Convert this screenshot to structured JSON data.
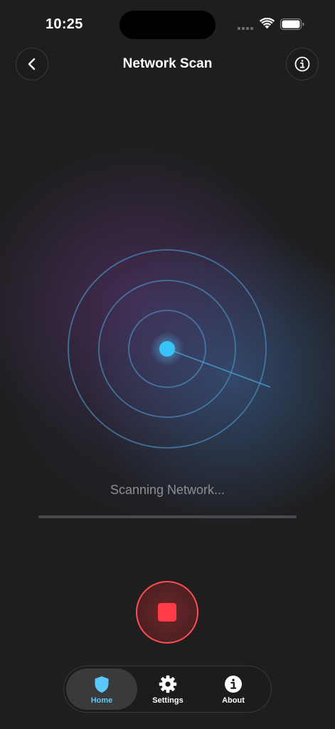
{
  "status_bar": {
    "time": "10:25"
  },
  "header": {
    "title": "Network Scan",
    "back_icon": "chevron-left-icon",
    "info_icon": "info-circle-icon"
  },
  "scan": {
    "status_text": "Scanning Network...",
    "progress": 0
  },
  "stop_control": {
    "icon": "stop-square-icon"
  },
  "tab_bar": {
    "tabs": [
      {
        "label": "Home",
        "icon": "shield-icon",
        "active": true
      },
      {
        "label": "Settings",
        "icon": "gear-icon",
        "active": false
      },
      {
        "label": "About",
        "icon": "info-icon",
        "active": false
      }
    ]
  },
  "colors": {
    "accent": "#5ac8fa",
    "radar_ring": "#4a88b8",
    "stop_red": "#ff3b45",
    "background": "#1e1e1f"
  }
}
